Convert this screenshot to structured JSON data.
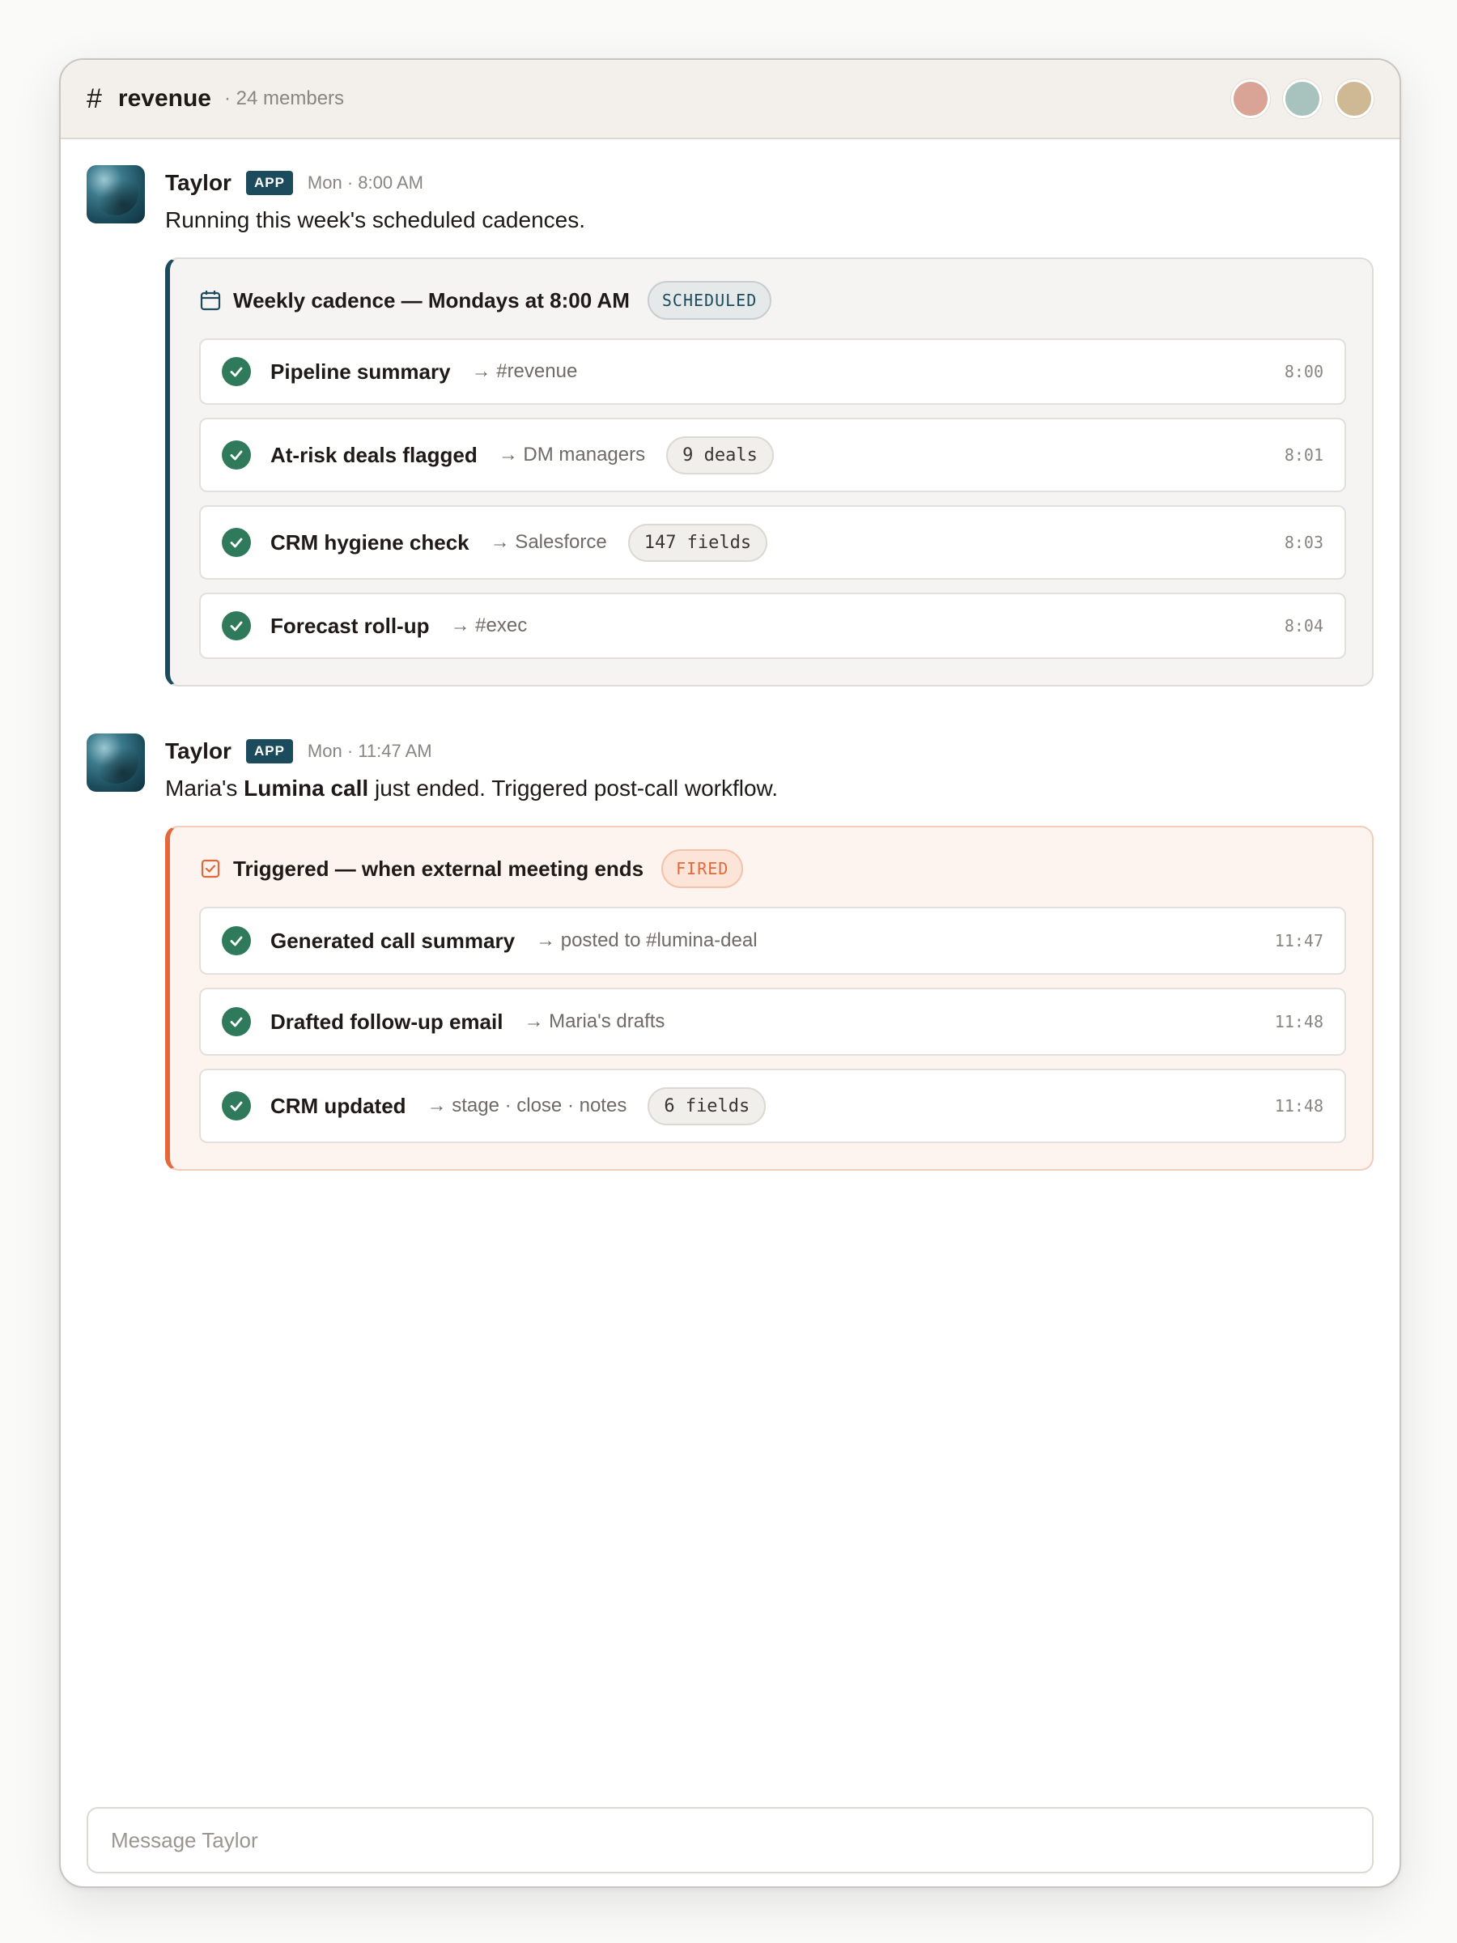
{
  "channel": {
    "hash": "#",
    "name": "revenue",
    "members": "· 24 members",
    "avatar_colors": [
      "#d9a396",
      "#a8c3bd",
      "#cfb995"
    ]
  },
  "messages": [
    {
      "author": "Taylor",
      "badge": "APP",
      "time": "Mon · 8:00 AM",
      "text": "Running this week's scheduled cadences.",
      "card": {
        "icon": "calendar-icon",
        "title": "Weekly cadence — Mondays at 8:00 AM",
        "status": "SCHEDULED",
        "accent": "#1b4b5c",
        "rows": [
          {
            "title": "Pipeline summary",
            "dest": "→ #revenue",
            "pill": "",
            "time": "8:00"
          },
          {
            "title": "At-risk deals flagged",
            "dest": "→ DM managers",
            "pill": "9 deals",
            "time": "8:01"
          },
          {
            "title": "CRM hygiene check",
            "dest": "→ Salesforce",
            "pill": "147 fields",
            "time": "8:03"
          },
          {
            "title": "Forecast roll-up",
            "dest": "→ #exec",
            "pill": "",
            "time": "8:04"
          }
        ]
      }
    },
    {
      "author": "Taylor",
      "badge": "APP",
      "time": "Mon · 11:47 AM",
      "text_parts": {
        "before": "Maria's ",
        "bold": "Lumina call",
        "after": " just ended. Triggered post-call workflow."
      },
      "card": {
        "icon": "checkbox-icon",
        "title": "Triggered — when external meeting ends",
        "status": "FIRED",
        "accent": "#e4683a",
        "rows": [
          {
            "title": "Generated call summary",
            "dest": "→ posted to #lumina-deal",
            "pill": "",
            "time": "11:47"
          },
          {
            "title": "Drafted follow-up email",
            "dest": "→ Maria's drafts",
            "pill": "",
            "time": "11:48"
          },
          {
            "title": "CRM updated",
            "dest": "→ stage · close · notes",
            "pill": "6 fields",
            "time": "11:48"
          }
        ]
      }
    }
  ],
  "composer": {
    "placeholder": "Message Taylor"
  },
  "colors": {
    "success": "#2f7a5b",
    "app_badge": "#1b4b5c"
  }
}
